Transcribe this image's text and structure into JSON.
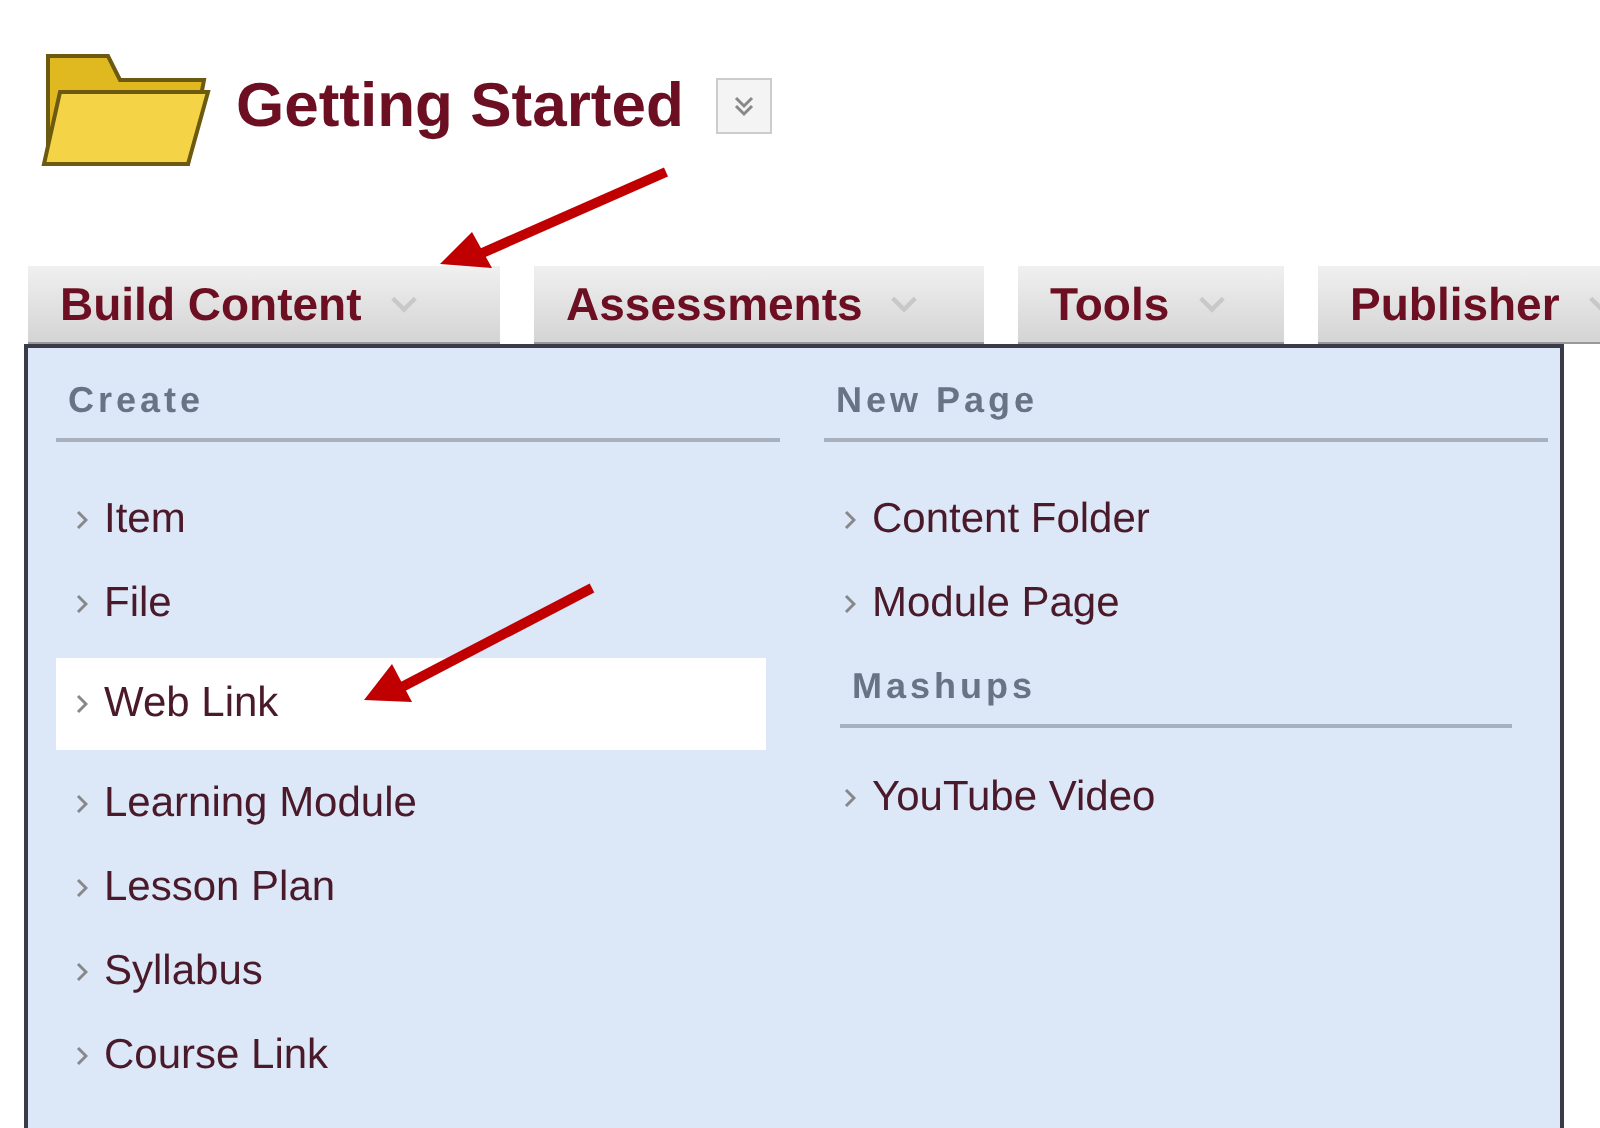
{
  "header": {
    "title": "Getting Started"
  },
  "tabs": [
    {
      "label": "Build Content"
    },
    {
      "label": "Assessments"
    },
    {
      "label": "Tools"
    },
    {
      "label": "Publisher"
    }
  ],
  "menu": {
    "columns": [
      {
        "sections": [
          {
            "heading": "Create",
            "items": [
              {
                "label": "Item",
                "selected": false
              },
              {
                "label": "File",
                "selected": false
              },
              {
                "label": "Web Link",
                "selected": true
              },
              {
                "label": "Learning Module",
                "selected": false
              },
              {
                "label": "Lesson Plan",
                "selected": false
              },
              {
                "label": "Syllabus",
                "selected": false
              },
              {
                "label": "Course Link",
                "selected": false
              }
            ]
          }
        ]
      },
      {
        "sections": [
          {
            "heading": "New Page",
            "items": [
              {
                "label": "Content Folder",
                "selected": false
              },
              {
                "label": "Module Page",
                "selected": false
              }
            ]
          },
          {
            "heading": "Mashups",
            "items": [
              {
                "label": "YouTube Video",
                "selected": false
              }
            ]
          }
        ]
      }
    ]
  }
}
